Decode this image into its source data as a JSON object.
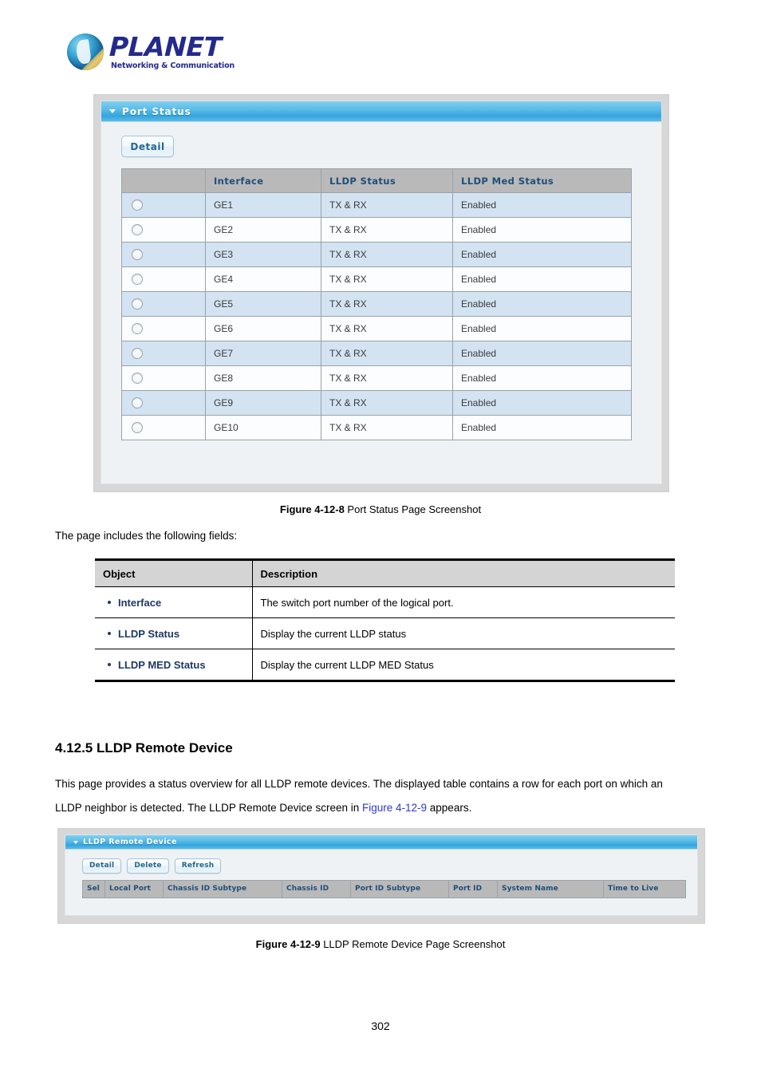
{
  "brand": {
    "name": "PLANET",
    "tagline": "Networking & Communication"
  },
  "port_status_panel": {
    "title": "Port Status",
    "collapse_icon": "triangle-down-icon",
    "detail_button": "Detail",
    "columns": [
      "",
      "Interface",
      "LLDP Status",
      "LLDP Med Status"
    ],
    "rows": [
      {
        "interface": "GE1",
        "lldp_status": "TX & RX",
        "lldp_med_status": "Enabled"
      },
      {
        "interface": "GE2",
        "lldp_status": "TX & RX",
        "lldp_med_status": "Enabled"
      },
      {
        "interface": "GE3",
        "lldp_status": "TX & RX",
        "lldp_med_status": "Enabled"
      },
      {
        "interface": "GE4",
        "lldp_status": "TX & RX",
        "lldp_med_status": "Enabled"
      },
      {
        "interface": "GE5",
        "lldp_status": "TX & RX",
        "lldp_med_status": "Enabled"
      },
      {
        "interface": "GE6",
        "lldp_status": "TX & RX",
        "lldp_med_status": "Enabled"
      },
      {
        "interface": "GE7",
        "lldp_status": "TX & RX",
        "lldp_med_status": "Enabled"
      },
      {
        "interface": "GE8",
        "lldp_status": "TX & RX",
        "lldp_med_status": "Enabled"
      },
      {
        "interface": "GE9",
        "lldp_status": "TX & RX",
        "lldp_med_status": "Enabled"
      },
      {
        "interface": "GE10",
        "lldp_status": "TX & RX",
        "lldp_med_status": "Enabled"
      }
    ]
  },
  "figure_8": {
    "label": "Figure 4-12-8",
    "text": " Port Status Page Screenshot"
  },
  "intro_line": "The page includes the following fields:",
  "object_table": {
    "headers": {
      "object": "Object",
      "description": "Description"
    },
    "rows": [
      {
        "object": "Interface",
        "description": "The switch port number of the logical port."
      },
      {
        "object": "LLDP Status",
        "description": "Display the current LLDP status"
      },
      {
        "object": "LLDP MED Status",
        "description": "Display the current LLDP MED Status"
      }
    ]
  },
  "section": {
    "heading": "4.12.5 LLDP Remote Device",
    "para_part1": "This page provides a status overview for all LLDP remote devices. The displayed table contains a row for each port on which an",
    "para_part2a": "LLDP neighbor is detected. The LLDP Remote Device screen in ",
    "para_link": "Figure 4-12-9",
    "para_part2b": " appears."
  },
  "remote_device_panel": {
    "title": "LLDP Remote Device",
    "collapse_icon": "triangle-down-icon",
    "buttons": [
      "Detail",
      "Delete",
      "Refresh"
    ],
    "columns": [
      "Sel",
      "Local Port",
      "Chassis ID Subtype",
      "Chassis ID",
      "Port ID Subtype",
      "Port ID",
      "System Name",
      "Time to Live"
    ],
    "rows": []
  },
  "figure_9": {
    "label": "Figure 4-12-9",
    "text": " LLDP Remote Device Page Screenshot"
  },
  "page_number": "302",
  "colors": {
    "panel_header_blue": "#36a5dd",
    "table_header_gray": "#b9b9b9",
    "header_text_blue": "#1f4e79",
    "row_odd": "#d3e3f2",
    "row_even": "#fbfdfe",
    "link_blue": "#2b39d6",
    "object_label": "#1f3864"
  }
}
